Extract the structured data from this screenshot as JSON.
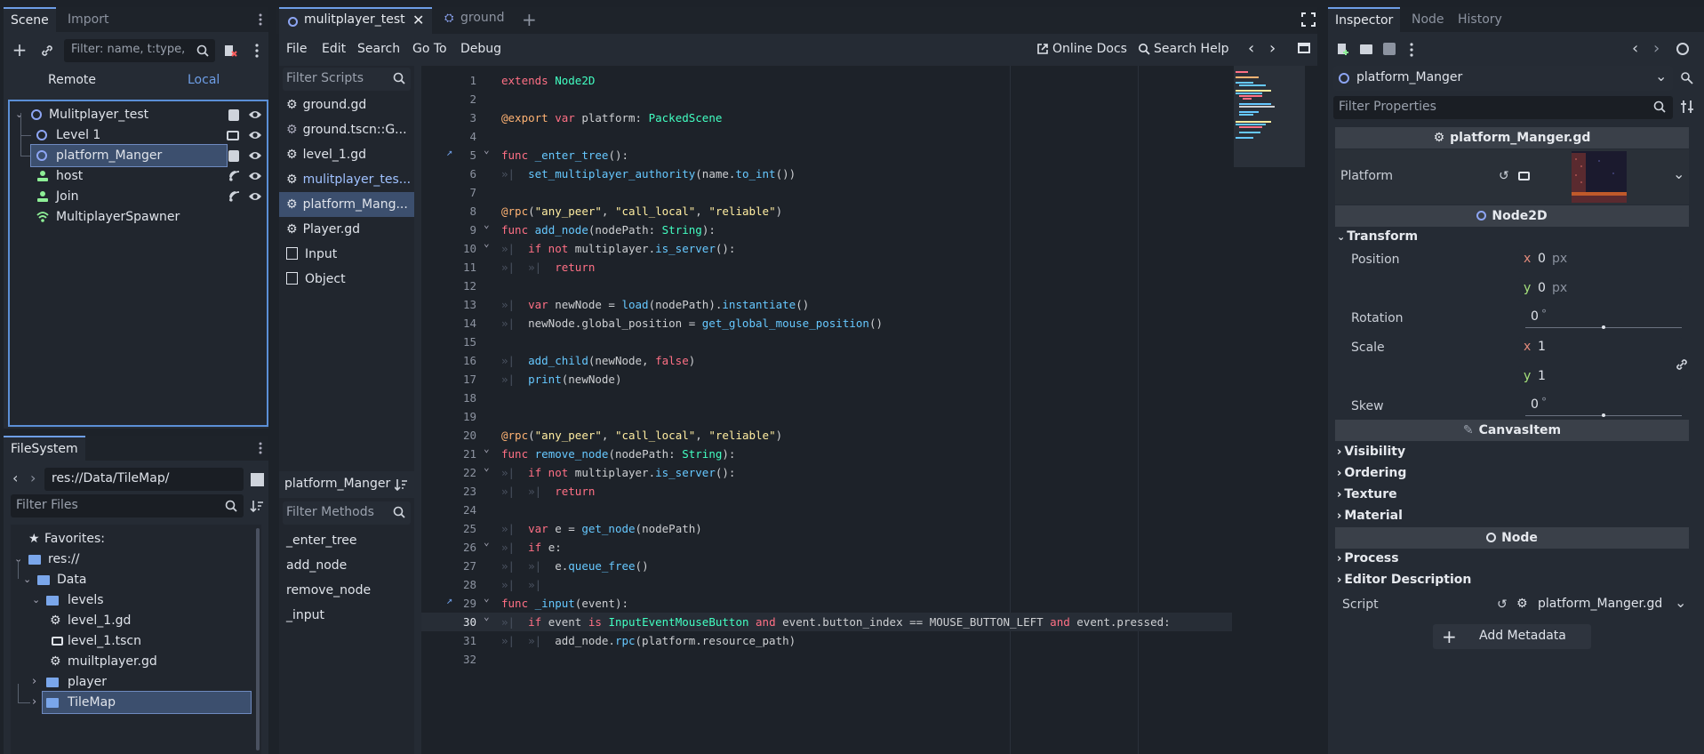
{
  "scene_dock": {
    "tabs": [
      "Scene",
      "Import"
    ],
    "filter_placeholder": "Filter: name, t:type,",
    "remote_label": "Remote",
    "local_label": "Local",
    "tree": [
      {
        "label": "Mulitplayer_test"
      },
      {
        "label": "Level 1"
      },
      {
        "label": "platform_Manger"
      },
      {
        "label": "host"
      },
      {
        "label": "Join"
      },
      {
        "label": "MultiplayerSpawner"
      }
    ]
  },
  "filesystem": {
    "tab": "FileSystem",
    "path": "res://Data/TileMap/",
    "filter_placeholder": "Filter Files",
    "items": [
      {
        "label": "Favorites:"
      },
      {
        "label": "res://"
      },
      {
        "label": "Data"
      },
      {
        "label": "levels"
      },
      {
        "label": "level_1.gd"
      },
      {
        "label": "level_1.tscn"
      },
      {
        "label": "muiltplayer.gd"
      },
      {
        "label": "player"
      },
      {
        "label": "TileMap"
      }
    ]
  },
  "editor_tabs": {
    "tabs": [
      "mulitplayer_test",
      "ground"
    ]
  },
  "script_menu": {
    "items": [
      "File",
      "Edit",
      "Search",
      "Go To",
      "Debug"
    ],
    "online_docs": "Online Docs",
    "search_help": "Search Help"
  },
  "scripts_panel": {
    "filter_placeholder": "Filter Scripts",
    "scripts": [
      "ground.gd",
      "ground.tscn::G...",
      "level_1.gd",
      "mulitplayer_tes...",
      "platform_Mang...",
      "Player.gd",
      "Input",
      "Object"
    ],
    "current_name": "platform_Manger",
    "methods_placeholder": "Filter Methods",
    "methods": [
      "_enter_tree",
      "add_node",
      "remove_node",
      "_input"
    ]
  },
  "code": {
    "line_numbers": [
      "1",
      "2",
      "3",
      "4",
      "5",
      "6",
      "7",
      "8",
      "9",
      "10",
      "11",
      "12",
      "13",
      "14",
      "15",
      "16",
      "17",
      "18",
      "19",
      "20",
      "21",
      "22",
      "23",
      "24",
      "25",
      "26",
      "27",
      "28",
      "29",
      "30",
      "31",
      "32"
    ],
    "current_line": 30
  },
  "inspector": {
    "tabs": [
      "Inspector",
      "Node",
      "History"
    ],
    "node_name": "platform_Manger",
    "filter_placeholder": "Filter Properties",
    "script_header": "platform_Manger.gd",
    "platform_label": "Platform",
    "node2d_header": "Node2D",
    "transform_label": "Transform",
    "position_label": "Position",
    "pos_x": "0",
    "pos_y": "0",
    "px": "px",
    "rotation_label": "Rotation",
    "rotation_value": "0",
    "scale_label": "Scale",
    "scale_x": "1",
    "scale_y": "1",
    "skew_label": "Skew",
    "skew_value": "0",
    "degree": "°",
    "x": "x",
    "y": "y",
    "canvas_header": "CanvasItem",
    "canvas_sections": [
      "Visibility",
      "Ordering",
      "Texture",
      "Material"
    ],
    "node_header": "Node",
    "node_sections": [
      "Process",
      "Editor Description"
    ],
    "script_label": "Script",
    "script_value": "platform_Manger.gd",
    "add_metadata": "Add Metadata"
  },
  "colors": {
    "accent": "#6e9ee6",
    "keyword": "#ff7085",
    "type": "#42ffc2",
    "function": "#66c8ff",
    "string": "#ffeda1",
    "annotation": "#ffb373"
  }
}
